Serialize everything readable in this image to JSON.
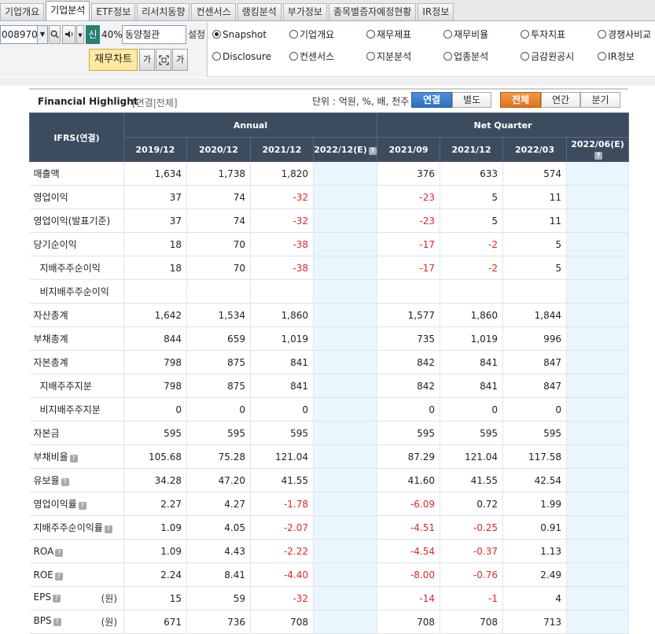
{
  "tabs": [
    "기업개요",
    "기업분석",
    "ETF정보",
    "리서치동향",
    "컨센서스",
    "랭킹분석",
    "부가정보",
    "종목별증자예정현황",
    "IR정보"
  ],
  "active_tab": "기업분석",
  "toolbar": {
    "code": "008970",
    "shin_label": "신",
    "ratio": "40%",
    "company": "동양철관",
    "setting_label": "설정",
    "chart_button": "재무차트",
    "ga_label": "가"
  },
  "radios": [
    {
      "label": "Snapshot",
      "checked": true
    },
    {
      "label": "기업개요",
      "checked": false
    },
    {
      "label": "재무제표",
      "checked": false
    },
    {
      "label": "재무비율",
      "checked": false
    },
    {
      "label": "투자지표",
      "checked": false
    },
    {
      "label": "경쟁사비교",
      "checked": false
    },
    {
      "label": "Disclosure",
      "checked": false
    },
    {
      "label": "컨센서스",
      "checked": false
    },
    {
      "label": "지분분석",
      "checked": false
    },
    {
      "label": "업종분석",
      "checked": false
    },
    {
      "label": "금감원공시",
      "checked": false
    },
    {
      "label": "IR정보",
      "checked": false
    }
  ],
  "highlight": {
    "title": "Financial Highlight",
    "subtitle": "[연결|전체]",
    "unit": "단위 : 억원, %, 배, 천주",
    "btn_consolidated": "연결",
    "btn_separate": "별도",
    "btn_all": "전체",
    "btn_annual": "연간",
    "btn_quarter": "분기"
  },
  "table": {
    "corner": "IFRS(연결)",
    "group_annual": "Annual",
    "group_quarter": "Net Quarter",
    "columns": [
      "2019/12",
      "2020/12",
      "2021/12",
      "2022/12(E)",
      "2021/09",
      "2021/12",
      "2022/03",
      "2022/06(E)"
    ],
    "unit_won": "(원)",
    "rows": [
      {
        "label": "매출액",
        "sub": false,
        "q": false,
        "won": false,
        "values": [
          "1,634",
          "1,738",
          "1,820",
          "",
          "376",
          "633",
          "574",
          ""
        ]
      },
      {
        "label": "영업이익",
        "sub": false,
        "q": false,
        "won": false,
        "values": [
          "37",
          "74",
          "-32",
          "",
          "-23",
          "5",
          "11",
          ""
        ]
      },
      {
        "label": "영업이익(발표기준)",
        "sub": false,
        "q": false,
        "won": false,
        "values": [
          "37",
          "74",
          "-32",
          "",
          "-23",
          "5",
          "11",
          ""
        ]
      },
      {
        "label": "당기순이익",
        "sub": false,
        "q": false,
        "won": false,
        "values": [
          "18",
          "70",
          "-38",
          "",
          "-17",
          "-2",
          "5",
          ""
        ]
      },
      {
        "label": "지배주주순이익",
        "sub": true,
        "q": false,
        "won": false,
        "values": [
          "18",
          "70",
          "-38",
          "",
          "-17",
          "-2",
          "5",
          ""
        ]
      },
      {
        "label": "비지배주주순이익",
        "sub": true,
        "q": false,
        "won": false,
        "values": [
          "",
          "",
          "",
          "",
          "",
          "",
          "",
          ""
        ]
      },
      {
        "label": "자산총계",
        "sub": false,
        "q": false,
        "won": false,
        "values": [
          "1,642",
          "1,534",
          "1,860",
          "",
          "1,577",
          "1,860",
          "1,844",
          ""
        ]
      },
      {
        "label": "부채총계",
        "sub": false,
        "q": false,
        "won": false,
        "values": [
          "844",
          "659",
          "1,019",
          "",
          "735",
          "1,019",
          "996",
          ""
        ]
      },
      {
        "label": "자본총계",
        "sub": false,
        "q": false,
        "won": false,
        "values": [
          "798",
          "875",
          "841",
          "",
          "842",
          "841",
          "847",
          ""
        ]
      },
      {
        "label": "지배주주지분",
        "sub": true,
        "q": false,
        "won": false,
        "values": [
          "798",
          "875",
          "841",
          "",
          "842",
          "841",
          "847",
          ""
        ]
      },
      {
        "label": "비지배주주지분",
        "sub": true,
        "q": false,
        "won": false,
        "values": [
          "0",
          "0",
          "0",
          "",
          "0",
          "0",
          "0",
          ""
        ]
      },
      {
        "label": "자본금",
        "sub": false,
        "q": false,
        "won": false,
        "values": [
          "595",
          "595",
          "595",
          "",
          "595",
          "595",
          "595",
          ""
        ]
      },
      {
        "label": "부채비율",
        "sub": false,
        "q": true,
        "won": false,
        "values": [
          "105.68",
          "75.28",
          "121.04",
          "",
          "87.29",
          "121.04",
          "117.58",
          ""
        ]
      },
      {
        "label": "유보율",
        "sub": false,
        "q": true,
        "won": false,
        "values": [
          "34.28",
          "47.20",
          "41.55",
          "",
          "41.60",
          "41.55",
          "42.54",
          ""
        ]
      },
      {
        "label": "영업이익률",
        "sub": false,
        "q": true,
        "won": false,
        "values": [
          "2.27",
          "4.27",
          "-1.78",
          "",
          "-6.09",
          "0.72",
          "1.99",
          ""
        ]
      },
      {
        "label": "지배주주순이익률",
        "sub": false,
        "q": true,
        "won": false,
        "values": [
          "1.09",
          "4.05",
          "-2.07",
          "",
          "-4.51",
          "-0.25",
          "0.91",
          ""
        ]
      },
      {
        "label": "ROA",
        "sub": false,
        "q": true,
        "won": false,
        "values": [
          "1.09",
          "4.43",
          "-2.22",
          "",
          "-4.54",
          "-0.37",
          "1.13",
          ""
        ]
      },
      {
        "label": "ROE",
        "sub": false,
        "q": true,
        "won": false,
        "values": [
          "2.24",
          "8.41",
          "-4.40",
          "",
          "-8.00",
          "-0.76",
          "2.49",
          ""
        ]
      },
      {
        "label": "EPS",
        "sub": false,
        "q": true,
        "won": true,
        "values": [
          "15",
          "59",
          "-32",
          "",
          "-14",
          "-1",
          "4",
          ""
        ]
      },
      {
        "label": "BPS",
        "sub": false,
        "q": true,
        "won": true,
        "values": [
          "671",
          "736",
          "708",
          "",
          "708",
          "708",
          "713",
          ""
        ]
      }
    ]
  },
  "colors": {
    "header": "#3c4b5e",
    "negative": "#e02626",
    "estimate": "#e9f6fd",
    "tab_blue": "#2d6fbf",
    "tab_orange": "#e0711d"
  },
  "icons": {
    "help": "question-icon",
    "search": "search-icon",
    "speaker": "speaker-icon"
  }
}
